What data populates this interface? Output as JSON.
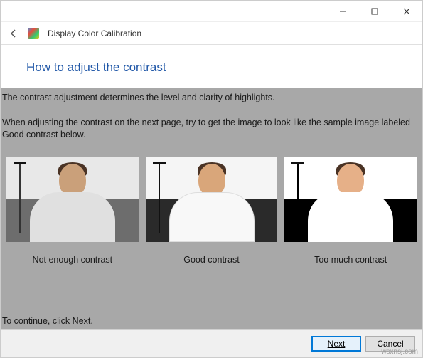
{
  "window": {
    "title": "Display Color Calibration"
  },
  "page": {
    "heading": "How to adjust the contrast",
    "para1": "The contrast adjustment determines the level and clarity of highlights.",
    "para2": "When adjusting the contrast on the next page, try to get the image to look like the sample image labeled Good contrast below.",
    "continue_hint": "To continue, click Next."
  },
  "samples": {
    "low": "Not enough contrast",
    "good": "Good contrast",
    "high": "Too much contrast"
  },
  "buttons": {
    "next": "Next",
    "cancel": "Cancel"
  },
  "watermark": "wsxnsj.com"
}
